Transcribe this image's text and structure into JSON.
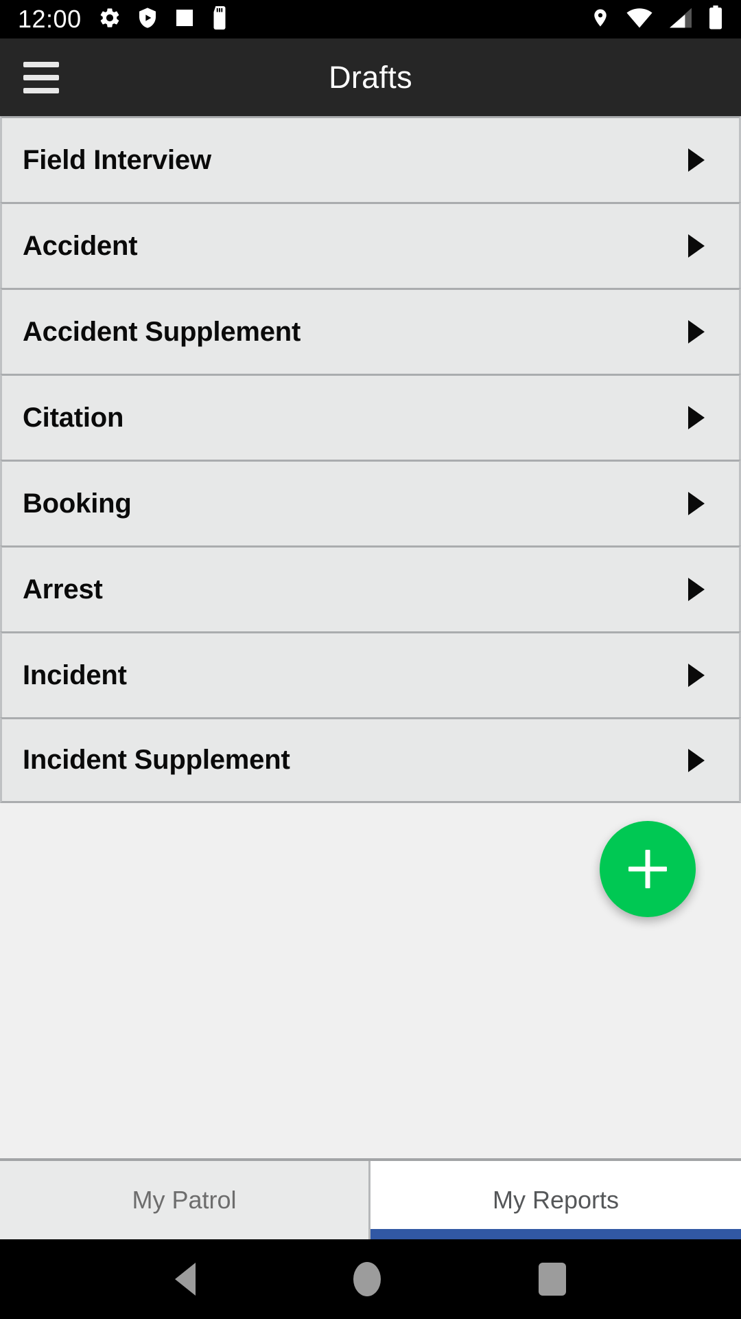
{
  "status_bar": {
    "time": "12:00",
    "left_icons": [
      "gear-icon",
      "shield-play-icon",
      "square-icon",
      "sd-card-icon"
    ],
    "right_icons": [
      "location-pin-icon",
      "wifi-icon",
      "cellular-signal-icon",
      "battery-icon"
    ]
  },
  "app_bar": {
    "menu_icon": "hamburger-menu-icon",
    "title": "Drafts"
  },
  "list": {
    "items": [
      {
        "label": "Field Interview",
        "arrow": "chevron-right-icon"
      },
      {
        "label": "Accident",
        "arrow": "chevron-right-icon"
      },
      {
        "label": "Accident Supplement",
        "arrow": "chevron-right-icon"
      },
      {
        "label": "Citation",
        "arrow": "chevron-right-icon"
      },
      {
        "label": "Booking",
        "arrow": "chevron-right-icon"
      },
      {
        "label": "Arrest",
        "arrow": "chevron-right-icon"
      },
      {
        "label": "Incident",
        "arrow": "chevron-right-icon"
      },
      {
        "label": "Incident Supplement",
        "arrow": "chevron-right-icon"
      }
    ]
  },
  "fab": {
    "icon": "plus-icon",
    "color": "#00C853"
  },
  "tabs": [
    {
      "label": "My Patrol",
      "active": false
    },
    {
      "label": "My Reports",
      "active": true
    }
  ],
  "tab_accent_color": "#3158A4",
  "nav_bar": {
    "back": "back-triangle-icon",
    "home": "home-circle-icon",
    "recents": "recents-square-icon"
  }
}
